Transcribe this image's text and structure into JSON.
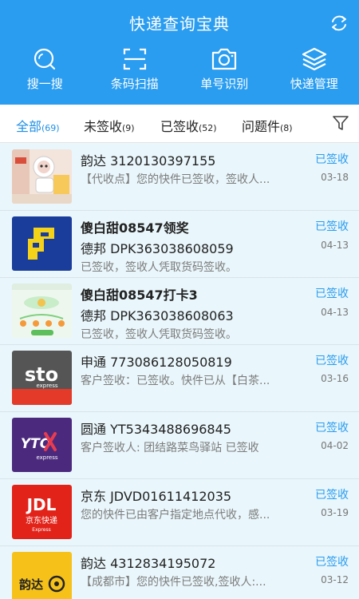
{
  "header": {
    "title": "快递查询宝典",
    "tools": [
      {
        "label": "搜一搜",
        "icon": "search-icon"
      },
      {
        "label": "条码扫描",
        "icon": "scan-icon"
      },
      {
        "label": "单号识别",
        "icon": "camera-icon"
      },
      {
        "label": "快递管理",
        "icon": "layers-icon"
      }
    ]
  },
  "tabs": [
    {
      "label": "全部",
      "count": "(69)"
    },
    {
      "label": "未签收",
      "count": "(9)"
    },
    {
      "label": "已签收",
      "count": "(52)"
    },
    {
      "label": "问题件",
      "count": "(8)"
    }
  ],
  "items": [
    {
      "title": "韵达 3120130397155",
      "note": "",
      "preview": "【代收点】您的快件已签收，签收人...",
      "status": "已签收",
      "date": "03-18",
      "logo": "product-photo"
    },
    {
      "title": "傻白甜08547领奖",
      "note": "德邦 DPK363038608059",
      "preview": "已签收，签收人凭取货码签收。",
      "status": "已签收",
      "date": "04-13",
      "logo": "deppon-logo"
    },
    {
      "title": "傻白甜08547打卡3",
      "note": "德邦 DPK363038608063",
      "preview": "已签收，签收人凭取货码签收。",
      "status": "已签收",
      "date": "04-13",
      "logo": "app-screenshot"
    },
    {
      "title": "申通 773086128050819",
      "note": "",
      "preview": "客户签收：已签收。快件已从【白茶...",
      "status": "已签收",
      "date": "03-16",
      "logo": "sto-logo",
      "logo_text": "sto",
      "logo_sub": "express"
    },
    {
      "title": "圆通 YT5343488696845",
      "note": "",
      "preview": "客户签收人: 团结路菜鸟驿站 已签收",
      "status": "已签收",
      "date": "04-02",
      "logo": "yto-logo",
      "logo_text": "YTO",
      "logo_sub": "express"
    },
    {
      "title": "京东 JDVD01611412035",
      "note": "",
      "preview": "您的快件已由客户指定地点代收，感...",
      "status": "已签收",
      "date": "03-19",
      "logo": "jdl-logo",
      "logo_text": "JDL",
      "logo_sub": "京东快递",
      "logo_sub2": "Express"
    },
    {
      "title": "韵达 4312834195072",
      "note": "",
      "preview": "【成都市】您的快件已签收,签收人:...",
      "status": "已签收",
      "date": "03-12",
      "logo": "yunda-logo",
      "logo_text": "韵达"
    }
  ],
  "colors": {
    "brand": "#2a9df0",
    "active_tab": "#1f8fe6",
    "item_bg": "#e9f6fb"
  }
}
